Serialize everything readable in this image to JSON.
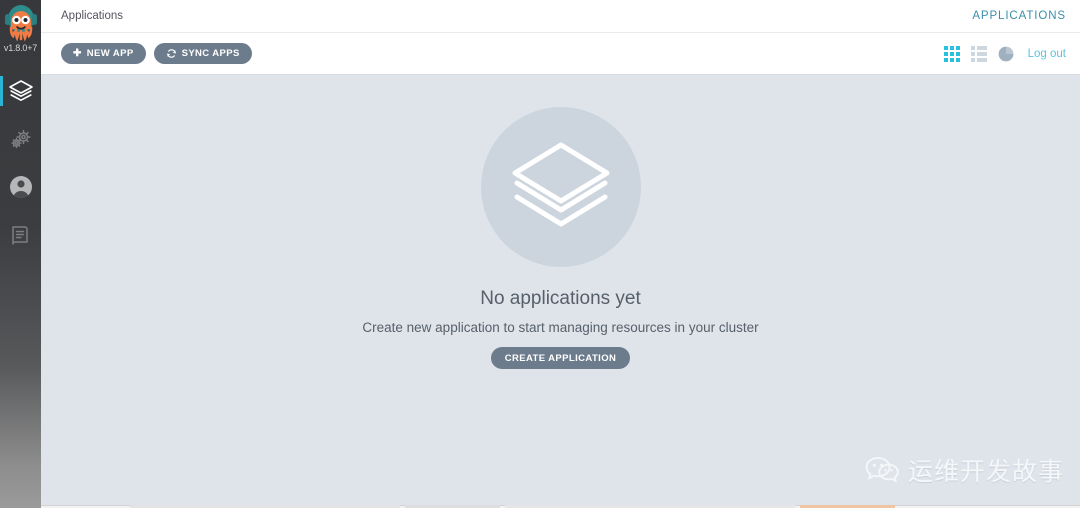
{
  "colors": {
    "sidebar_dark": "#36383b",
    "accent_teal": "#29b6d4",
    "link_teal": "#5bc4de",
    "section_label_teal": "#3a8fa8",
    "button_slate": "#6d7c8c",
    "content_bg": "#dfe4eb",
    "empty_circle": "#ccd5dd"
  },
  "sidebar": {
    "logo_icon": "argo-octopus-logo",
    "version": "v1.8.0+7",
    "items": [
      {
        "icon": "layers-icon",
        "name": "applications",
        "active": true
      },
      {
        "icon": "gears-icon",
        "name": "settings",
        "active": false
      },
      {
        "icon": "user-icon",
        "name": "user-info",
        "active": false
      },
      {
        "icon": "documentation-icon",
        "name": "documentation",
        "active": false
      }
    ]
  },
  "topbar": {
    "breadcrumb": "Applications",
    "section_label": "APPLICATIONS"
  },
  "toolbar": {
    "new_app_label": "NEW APP",
    "new_app_icon": "plus-icon",
    "sync_apps_label": "SYNC APPS",
    "sync_apps_icon": "refresh-icon",
    "view_toggles": [
      {
        "icon": "grid-view-icon",
        "name": "tiles-view",
        "active": true
      },
      {
        "icon": "list-view-icon",
        "name": "list-view",
        "active": false
      },
      {
        "icon": "pie-chart-icon",
        "name": "summary-view",
        "active": false
      }
    ],
    "logout_label": "Log out"
  },
  "empty_state": {
    "illustration_icon": "layers-stack-icon",
    "title": "No applications yet",
    "subtitle": "Create new application to start managing resources in your cluster",
    "cta_label": "CREATE APPLICATION"
  },
  "watermark": {
    "icon": "wechat-icon",
    "text": "运维开发故事"
  }
}
